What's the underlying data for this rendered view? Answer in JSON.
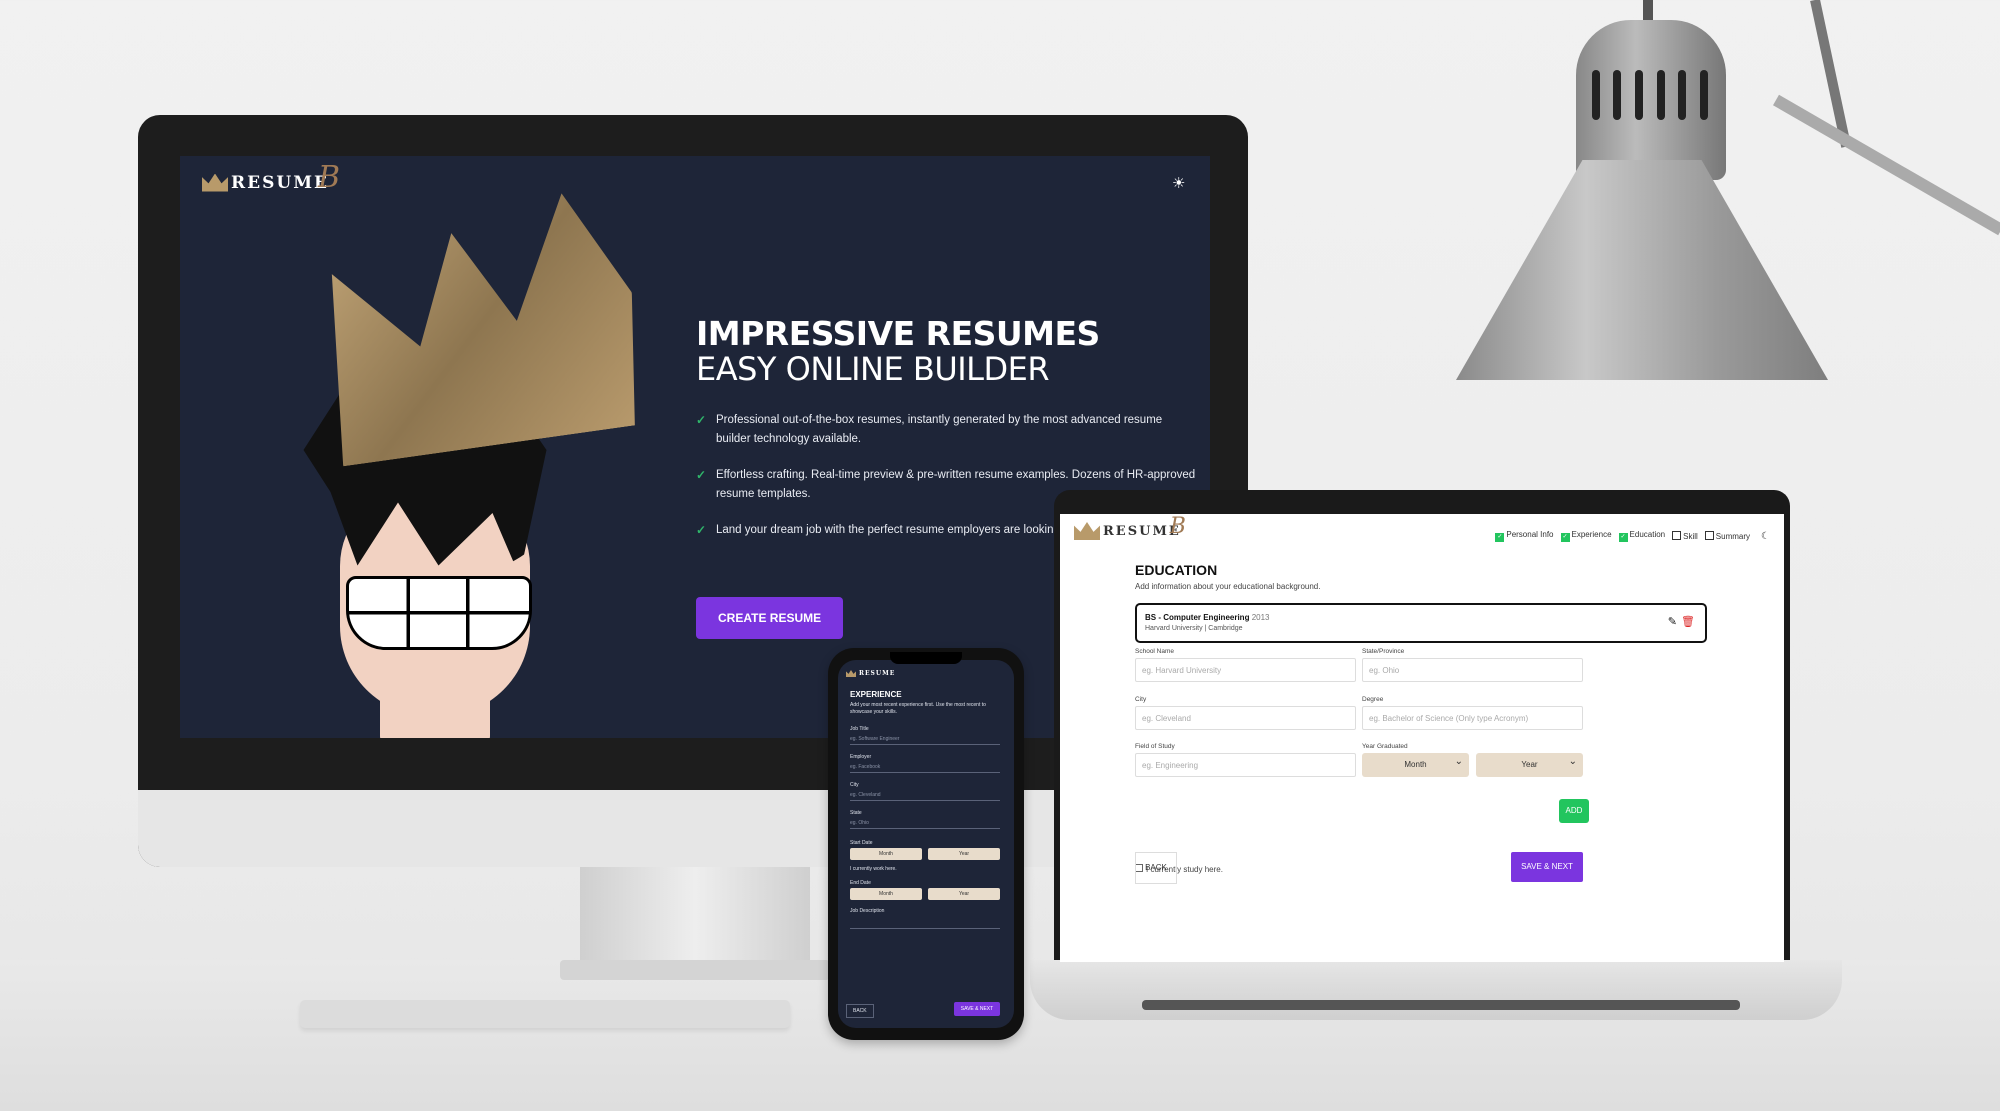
{
  "desktop": {
    "logo_word": "RESUME",
    "logo_letter": "B",
    "theme_icon": "☀",
    "hero": {
      "title": "IMPRESSIVE RESUMES",
      "subtitle": "EASY ONLINE BUILDER",
      "features": [
        "Professional out-of-the-box resumes, instantly generated by the most advanced resume builder technology available.",
        "Effortless crafting. Real-time preview & pre-written resume examples. Dozens of HR-approved resume templates.",
        "Land your dream job with the perfect resume employers are looking for!"
      ],
      "cta": "CREATE RESUME"
    }
  },
  "phone": {
    "title": "EXPERIENCE",
    "desc": "Add your most recent experience first. Use the most recent to showcase your skills.",
    "fields": [
      {
        "label": "Job Title",
        "placeholder": "eg. Software Engineer"
      },
      {
        "label": "Employer",
        "placeholder": "eg. Facebook"
      },
      {
        "label": "City",
        "placeholder": "eg. Cleveland"
      },
      {
        "label": "State",
        "placeholder": "eg. Ohio"
      }
    ],
    "start_label": "Start Date",
    "end_label": "End Date",
    "month": "Month",
    "year": "Year",
    "currently_work": "I currently work here.",
    "job_desc_label": "Job Description",
    "back": "BACK",
    "save": "SAVE & NEXT"
  },
  "laptop": {
    "logo_word": "RESUME",
    "logo_letter": "B",
    "steps": [
      "Personal Info",
      "Experience",
      "Education",
      "Skill",
      "Summary"
    ],
    "steps_done": [
      true,
      true,
      true,
      false,
      false
    ],
    "theme_icon": "☾",
    "title": "EDUCATION",
    "desc": "Add information about your educational background.",
    "card": {
      "title": "BS - Computer Engineering",
      "year": "2013",
      "meta": "Harvard University | Cambridge"
    },
    "labels": {
      "school": "School Name",
      "state": "State/Province",
      "city": "City",
      "degree": "Degree",
      "field": "Field of Study",
      "year_grad": "Year Graduated"
    },
    "placeholders": {
      "school": "eg. Harvard University",
      "state": "eg. Ohio",
      "city": "eg. Cleveland",
      "degree": "eg. Bachelor of Science (Only type Acronym)",
      "field": "eg. Engineering"
    },
    "month": "Month",
    "year": "Year",
    "currently": "I currently study here.",
    "add": "ADD",
    "back": "BACK",
    "save": "SAVE & NEXT"
  }
}
